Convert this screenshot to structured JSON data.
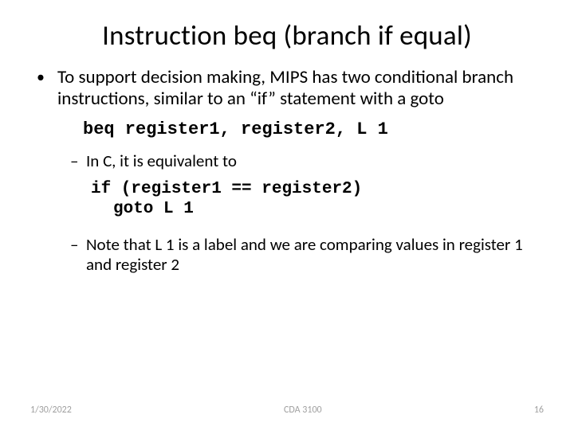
{
  "title": "Instruction beq (branch if equal)",
  "body": {
    "intro": "To support decision making, MIPS has two conditional branch instructions, similar to an “if” statement with a goto",
    "code_beq": "beq register1, register2, L 1",
    "equiv": "In C, it is equivalent to",
    "code_c": {
      "line1": "if (register1 == register2)",
      "line2": "goto  L 1"
    },
    "note": "Note that L 1 is a label and we are comparing values in register 1 and register 2"
  },
  "footer": {
    "date": "1/30/2022",
    "course": "CDA 3100",
    "page": "16"
  }
}
